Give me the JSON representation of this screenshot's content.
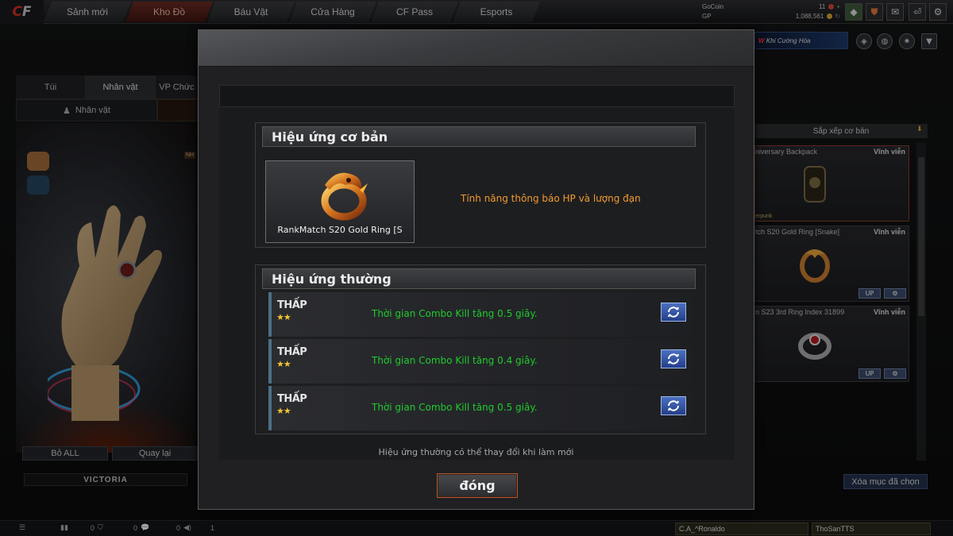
{
  "topbar": {
    "logo": "CF",
    "tabs": [
      "Sảnh mới",
      "Kho Đồ",
      "Báu Vật",
      "Cửa Hàng",
      "CF Pass",
      "Esports"
    ],
    "currency": {
      "gocoin_label": "GoCoin",
      "gocoin_value": "11",
      "gp_label": "GP",
      "gp_value": "1,088,561"
    }
  },
  "left": {
    "tabs": [
      "Túi",
      "Nhân vật",
      "VP Chức"
    ],
    "sub_tab": "Nhân vật",
    "badge": "NH",
    "buttons": {
      "all": "Bỏ ALL",
      "back": "Quay lại"
    },
    "character_name": "VICTORIA"
  },
  "right": {
    "banner_badge": "W",
    "banner_text": "Khí Cường Hóa",
    "sort_label": "Sắp xếp cơ bản",
    "items": [
      {
        "name": "niversary Backpack",
        "duration": "Vĩnh viễn",
        "sub": "erpunk"
      },
      {
        "name": "tch S20 Gold Ring [Snake]",
        "duration": "Vĩnh viễn"
      },
      {
        "name": "n S23 3rd Ring Index 31899",
        "duration": "Vĩnh viễn"
      }
    ],
    "card_btn_label": "UP",
    "clear_label": "Xóa mục đã chọn"
  },
  "bottombar": {
    "counts": [
      "0",
      "0",
      "0",
      "1"
    ],
    "friends": [
      "C.A_^Ronaldo",
      "ThoSanTTS"
    ]
  },
  "modal": {
    "base_section_title": "Hiệu ứng cơ bản",
    "item_name": "RankMatch S20 Gold Ring [S",
    "base_effect": "Tính năng thông báo HP và lượng đạn",
    "normal_section_title": "Hiệu ứng thường",
    "effects": [
      {
        "tier": "THẤP",
        "stars": "★★",
        "text": "Thời gian Combo Kill tăng 0.5 giây."
      },
      {
        "tier": "THẤP",
        "stars": "★★",
        "text": "Thời gian Combo Kill tăng 0.4 giây."
      },
      {
        "tier": "THẤP",
        "stars": "★★",
        "text": "Thời gian Combo Kill tăng 0.5 giây."
      }
    ],
    "footnote": "Hiệu ứng thường có thể thay đổi khi làm mới",
    "close_label": "đóng"
  },
  "colors": {
    "effect_green": "#1fcc2c",
    "base_effect_orange": "#f39b2f",
    "star_gold": "#f2c232",
    "accent_red": "#b35b31"
  },
  "icons": [
    "stats-icon",
    "refresh-icon",
    "character-icon",
    "backpack-icon",
    "settings-icon",
    "power-icon",
    "exit-icon",
    "refresh-effect-icon",
    "microphone-icon",
    "shield-icon",
    "chat-icon",
    "volume-icon"
  ]
}
